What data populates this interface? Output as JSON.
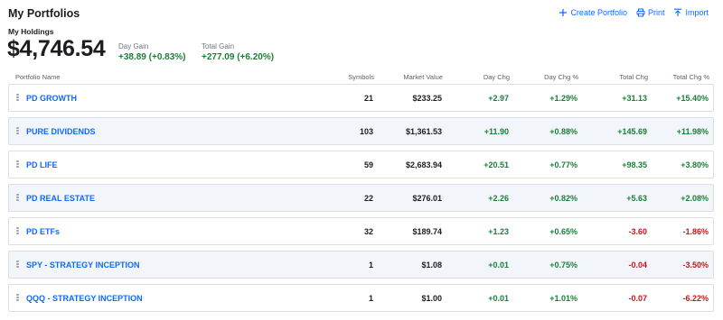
{
  "header": {
    "title": "My Portfolios",
    "actions": [
      {
        "label": "Create Portfolio",
        "icon": "plus-icon"
      },
      {
        "label": "Print",
        "icon": "printer-icon"
      },
      {
        "label": "Import",
        "icon": "import-icon"
      }
    ]
  },
  "holdings": {
    "label": "My Holdings",
    "total_value": "$4,746.54",
    "day_gain_label": "Day Gain",
    "day_gain_value": "+38.89 (+0.83%)",
    "total_gain_label": "Total Gain",
    "total_gain_value": "+277.09 (+6.20%)"
  },
  "colors": {
    "link": "#0f69ff",
    "positive": "#1a7f37",
    "negative": "#c4151c",
    "alt_row": "#f2f6fb"
  },
  "table": {
    "columns": [
      "Portfolio Name",
      "Symbols",
      "Market Value",
      "Day Chg",
      "Day Chg %",
      "Total Chg",
      "Total Chg %"
    ],
    "rows": [
      {
        "name": "PD GROWTH",
        "symbols": "21",
        "market_value": "$233.25",
        "day_chg": "+2.97",
        "day_chg_pct": "+1.29%",
        "total_chg": "+31.13",
        "total_chg_pct": "+15.40%"
      },
      {
        "name": "PURE DIVIDENDS",
        "symbols": "103",
        "market_value": "$1,361.53",
        "day_chg": "+11.90",
        "day_chg_pct": "+0.88%",
        "total_chg": "+145.69",
        "total_chg_pct": "+11.98%"
      },
      {
        "name": "PD LIFE",
        "symbols": "59",
        "market_value": "$2,683.94",
        "day_chg": "+20.51",
        "day_chg_pct": "+0.77%",
        "total_chg": "+98.35",
        "total_chg_pct": "+3.80%"
      },
      {
        "name": "PD REAL ESTATE",
        "symbols": "22",
        "market_value": "$276.01",
        "day_chg": "+2.26",
        "day_chg_pct": "+0.82%",
        "total_chg": "+5.63",
        "total_chg_pct": "+2.08%"
      },
      {
        "name": "PD ETFs",
        "symbols": "32",
        "market_value": "$189.74",
        "day_chg": "+1.23",
        "day_chg_pct": "+0.65%",
        "total_chg": "-3.60",
        "total_chg_pct": "-1.86%"
      },
      {
        "name": "SPY - STRATEGY INCEPTION",
        "symbols": "1",
        "market_value": "$1.08",
        "day_chg": "+0.01",
        "day_chg_pct": "+0.75%",
        "total_chg": "-0.04",
        "total_chg_pct": "-3.50%"
      },
      {
        "name": "QQQ - STRATEGY INCEPTION",
        "symbols": "1",
        "market_value": "$1.00",
        "day_chg": "+0.01",
        "day_chg_pct": "+1.01%",
        "total_chg": "-0.07",
        "total_chg_pct": "-6.22%"
      }
    ]
  }
}
